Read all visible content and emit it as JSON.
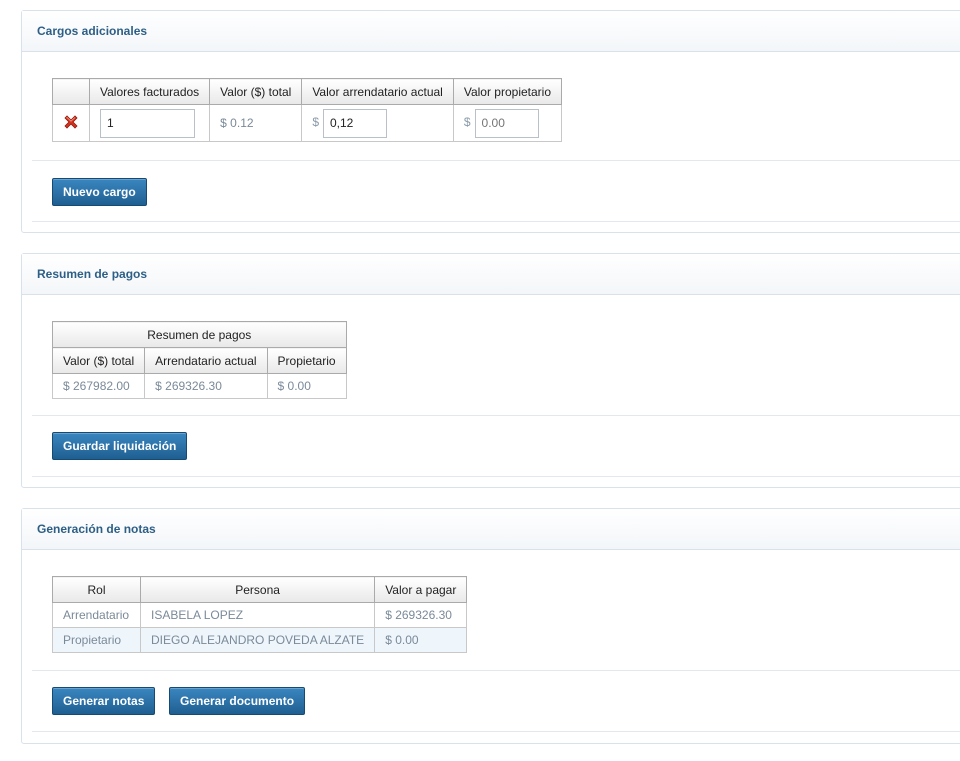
{
  "cargos": {
    "title": "Cargos adicionales",
    "headers": [
      "Valores facturados",
      "Valor ($) total",
      "Valor arrendatario actual",
      "Valor propietario"
    ],
    "row": {
      "facturados_value": "1",
      "total": "$ 0.12",
      "currency": "$",
      "arrendatario_value": "0,12",
      "propietario_placeholder": "0.00"
    },
    "button": "Nuevo cargo"
  },
  "resumen": {
    "title": "Resumen de pagos",
    "table_title": "Resumen de pagos",
    "headers": [
      "Valor ($) total",
      "Arrendatario actual",
      "Propietario"
    ],
    "values": [
      "$ 267982.00",
      "$ 269326.30",
      "$ 0.00"
    ],
    "button": "Guardar liquidación"
  },
  "notas": {
    "title": "Generación de notas",
    "headers": [
      "Rol",
      "Persona",
      "Valor a pagar"
    ],
    "rows": [
      {
        "rol": "Arrendatario",
        "persona": "ISABELA LOPEZ",
        "valor": "$ 269326.30"
      },
      {
        "rol": "Propietario",
        "persona": "DIEGO ALEJANDRO POVEDA ALZATE",
        "valor": "$ 0.00"
      }
    ],
    "buttons": [
      "Generar notas",
      "Generar documento"
    ]
  },
  "icons": {
    "delete": "red-x-delete-icon"
  },
  "colors": {
    "header_text": "#2d5f86",
    "button": "#2a6fa6",
    "muted_text": "#7a8a99"
  }
}
